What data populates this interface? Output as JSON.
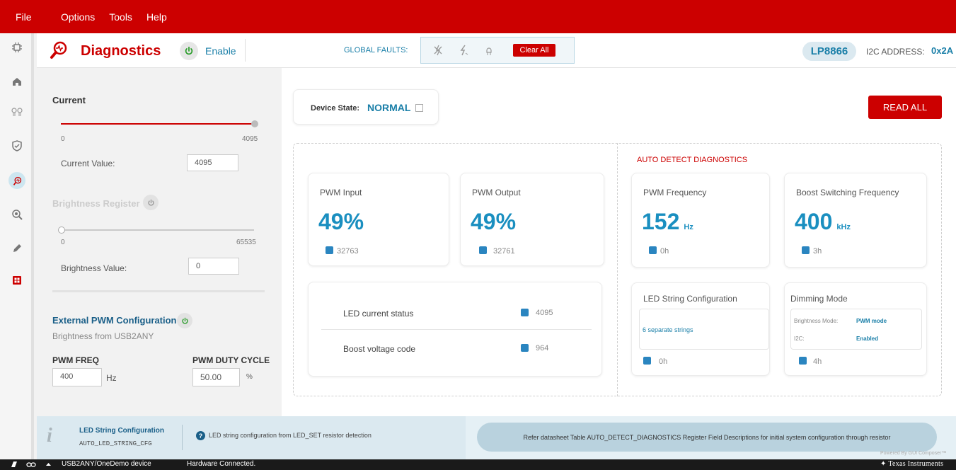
{
  "menu": {
    "file": "File",
    "options": "Options",
    "tools": "Tools",
    "help": "Help"
  },
  "header": {
    "title": "Diagnostics",
    "enable_label": "Enable",
    "global_faults_label": "GLOBAL FAULTS:",
    "clear_all": "Clear All",
    "device_chip": "LP8866",
    "i2c_label": "I2C ADDRESS:",
    "i2c_value": "0x2A"
  },
  "left_panel": {
    "current": {
      "title": "Current",
      "min": "0",
      "max": "4095",
      "value_label": "Current Value:",
      "value": "4095",
      "level": 1.0
    },
    "brightness": {
      "title": "Brightness Register",
      "min": "0",
      "max": "65535",
      "value_label": "Brightness Value:",
      "value": "0",
      "level": 0.0
    },
    "external_pwm": {
      "title": "External PWM Configuration",
      "subtitle": "Brightness from USB2ANY",
      "freq_label": "PWM FREQ",
      "freq_value": "400",
      "freq_unit": "Hz",
      "duty_label": "PWM DUTY CYCLE",
      "duty_value": "50.00",
      "duty_unit": "%"
    }
  },
  "main": {
    "device_state_label": "Device State:",
    "device_state_value": "NORMAL",
    "read_all": "READ ALL",
    "auto_detect_title": "AUTO DETECT DIAGNOSTICS",
    "pwm_input": {
      "label": "PWM Input",
      "value": "49%",
      "raw": "32763"
    },
    "pwm_output": {
      "label": "PWM Output",
      "value": "49%",
      "raw": "32761"
    },
    "pwm_frequency": {
      "label": "PWM Frequency",
      "value": "152",
      "unit": "Hz",
      "raw": "0h"
    },
    "boost_freq": {
      "label": "Boost Switching Frequency",
      "value": "400",
      "unit": "kHz",
      "raw": "3h"
    },
    "status": {
      "led_current_label": "LED current status",
      "led_current_value": "4095",
      "boost_voltage_label": "Boost voltage code",
      "boost_voltage_value": "964"
    },
    "led_string": {
      "label": "LED String Configuration",
      "value": "6 separate strings",
      "raw": "0h"
    },
    "dimming": {
      "label": "Dimming Mode",
      "brightness_mode_key": "Brightness Mode:",
      "brightness_mode_val": "PWM mode",
      "i2c_key": "I2C:",
      "i2c_val": "Enabled",
      "raw": "4h"
    }
  },
  "footer": {
    "title": "LED String Configuration",
    "subtitle": "AUTO_LED_STRING_CFG",
    "description": "LED string configuration from LED_SET resistor detection",
    "hint": "Refer datasheet Table AUTO_DETECT_DIAGNOSTICS Register Field Descriptions for initial system configuration through resistor",
    "powered": "Powered By GUI Composer™"
  },
  "statusbar": {
    "device": "USB2ANY/OneDemo device",
    "connection": "Hardware Connected.",
    "brand": "Texas Instruments"
  },
  "colors": {
    "accent_red": "#cc0000",
    "accent_blue": "#1a8fc0",
    "chip_bg": "#dbe9f0"
  }
}
